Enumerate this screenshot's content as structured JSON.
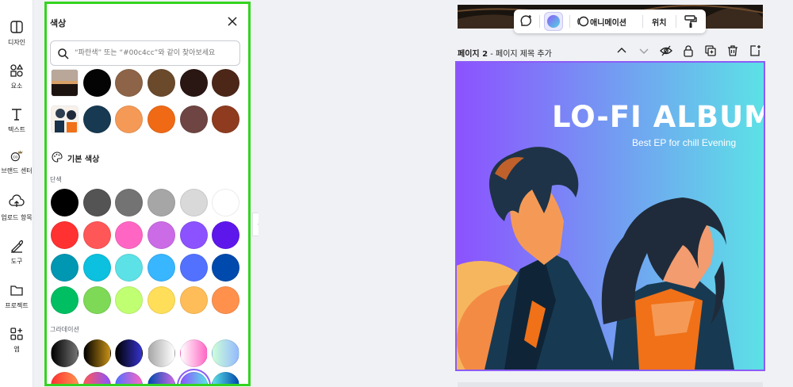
{
  "sidebar": {
    "items": [
      {
        "label": "디자인",
        "icon": "design-icon"
      },
      {
        "label": "요소",
        "icon": "elements-icon"
      },
      {
        "label": "텍스트",
        "icon": "text-icon"
      },
      {
        "label": "브랜드 센터",
        "icon": "brand-icon"
      },
      {
        "label": "업로드 항목",
        "icon": "upload-icon"
      },
      {
        "label": "도구",
        "icon": "tools-icon"
      },
      {
        "label": "프로젝트",
        "icon": "folder-icon"
      },
      {
        "label": "앱",
        "icon": "apps-icon"
      }
    ]
  },
  "color_panel": {
    "title": "색상",
    "search_placeholder": "“파란색” 또는 “#00c4cc”와 같이 찾아보세요",
    "document_colors_row1": [
      "photo",
      "#050404",
      "#8d6447",
      "#6b4a2c",
      "#2a1612",
      "#4c2718"
    ],
    "document_colors_row2": [
      "illustration",
      "#173a52",
      "#f59a56",
      "#f06a16",
      "#6e4542",
      "#8e3b1f"
    ],
    "basic_colors_title": "기본 색상",
    "solid_label": "단색",
    "solid_rows": [
      [
        "#000000",
        "#545454",
        "#737373",
        "#a6a6a6",
        "#d9d9d9",
        "#ffffff"
      ],
      [
        "#ff3131",
        "#ff5757",
        "#ff66c4",
        "#cb6ce6",
        "#8c52ff",
        "#5e17eb"
      ],
      [
        "#0097b2",
        "#0cc0df",
        "#5ce1e6",
        "#38b6ff",
        "#5271ff",
        "#004aad"
      ],
      [
        "#00bf63",
        "#7ed957",
        "#c1ff72",
        "#ffde59",
        "#ffbd59",
        "#ff914d"
      ]
    ],
    "gradient_label": "그라데이션",
    "gradient_rows": [
      [
        "linear-gradient(90deg,#000000,#737373)",
        "linear-gradient(90deg,#000000,#c89116)",
        "linear-gradient(90deg,#000000,#3533cd)",
        "linear-gradient(90deg,#a6a6a6,#ffffff)",
        "linear-gradient(90deg,#ffffff,#ff66c4)",
        "linear-gradient(90deg,#cdffd8,#94b9ff)"
      ],
      [
        "linear-gradient(90deg,#ff3131,#ff914d)",
        "linear-gradient(90deg,#ff5757,#8c52ff)",
        "linear-gradient(90deg,#5170ff,#ff66c4)",
        "linear-gradient(90deg,#004aad,#cb6ce6)",
        "linear-gradient(90deg,#8c52ff,#5ce1e6)",
        "linear-gradient(90deg,#5de0e6,#004aad)"
      ]
    ]
  },
  "toolbar": {
    "animate_label": "애니메이션",
    "position_label": "위치"
  },
  "page": {
    "number_label": "페이지 2",
    "title_placeholder": "- 페이지 제목 추가"
  },
  "design": {
    "headline": "LO-FI ALBUM",
    "subline": "Best EP for chill Evening",
    "gradient_start": "#8c52ff",
    "gradient_end": "#5ce1e6"
  }
}
